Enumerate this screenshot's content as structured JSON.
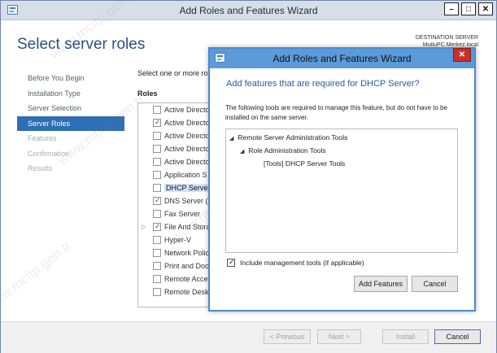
{
  "window": {
    "title": "Add Roles and Features Wizard",
    "controls": [
      "–",
      "□",
      "✕"
    ]
  },
  "page": {
    "heading": "Select server roles",
    "destination_label": "DESTINATION SERVER",
    "destination_value": "MutluPC.Merkez.local",
    "instruction": "Select one or more ro",
    "roles_header": "Roles"
  },
  "nav": [
    {
      "label": "Before You Begin",
      "state": "done"
    },
    {
      "label": "Installation Type",
      "state": "done"
    },
    {
      "label": "Server Selection",
      "state": "done"
    },
    {
      "label": "Server Roles",
      "state": "active"
    },
    {
      "label": "Features",
      "state": "disabled"
    },
    {
      "label": "Confirmation",
      "state": "disabled"
    },
    {
      "label": "Results",
      "state": "disabled"
    }
  ],
  "roles": [
    {
      "label": "Active Directo",
      "checked": false,
      "selected": false,
      "expandable": false
    },
    {
      "label": "Active Directo",
      "checked": true,
      "selected": false,
      "expandable": false
    },
    {
      "label": "Active Directo",
      "checked": false,
      "selected": false,
      "expandable": false
    },
    {
      "label": "Active Directo",
      "checked": false,
      "selected": false,
      "expandable": false
    },
    {
      "label": "Active Directo",
      "checked": false,
      "selected": false,
      "expandable": false
    },
    {
      "label": "Application S",
      "checked": false,
      "selected": false,
      "expandable": false
    },
    {
      "label": "DHCP Server",
      "checked": false,
      "selected": true,
      "expandable": false
    },
    {
      "label": "DNS Server (I",
      "checked": true,
      "selected": false,
      "expandable": false
    },
    {
      "label": "Fax Server",
      "checked": false,
      "selected": false,
      "expandable": false
    },
    {
      "label": "File And Stora",
      "checked": true,
      "selected": false,
      "expandable": true
    },
    {
      "label": "Hyper-V",
      "checked": false,
      "selected": false,
      "expandable": false
    },
    {
      "label": "Network Polic",
      "checked": false,
      "selected": false,
      "expandable": false
    },
    {
      "label": "Print and Doc",
      "checked": false,
      "selected": false,
      "expandable": false
    },
    {
      "label": "Remote Acce",
      "checked": false,
      "selected": false,
      "expandable": false
    },
    {
      "label": "Remote Desk",
      "checked": false,
      "selected": false,
      "expandable": false
    }
  ],
  "footer": {
    "previous": "< Previous",
    "next": "Next >",
    "install": "Install",
    "cancel": "Cancel"
  },
  "dialog": {
    "title": "Add Roles and Features Wizard",
    "close": "✕",
    "heading": "Add features that are required for DHCP Server?",
    "description": "The following tools are required to manage this feature, but do not have to be installed on the same server.",
    "tree": [
      {
        "label": "Remote Server Administration Tools",
        "level": 0,
        "expander": "◢"
      },
      {
        "label": "Role Administration Tools",
        "level": 1,
        "expander": "◢"
      },
      {
        "label": "[Tools] DHCP Server Tools",
        "level": 2,
        "expander": ""
      }
    ],
    "include_tools_label": "Include management tools (if applicable)",
    "include_tools_checked": true,
    "add_features": "Add Features",
    "cancel": "Cancel"
  },
  "watermark": "www.mcitp.gen.tr"
}
